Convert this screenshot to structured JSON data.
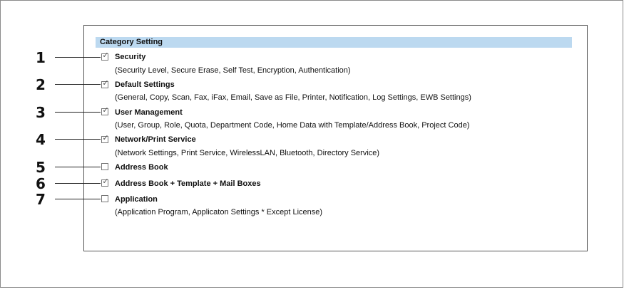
{
  "category_setting": {
    "header": "Category Setting",
    "items": [
      {
        "number": "1",
        "checked": true,
        "title": "Security",
        "description": "(Security Level, Secure Erase, Self Test, Encryption, Authentication)"
      },
      {
        "number": "2",
        "checked": true,
        "title": "Default Settings",
        "description": "(General, Copy, Scan, Fax, iFax, Email, Save as File, Printer, Notification, Log Settings, EWB Settings)"
      },
      {
        "number": "3",
        "checked": true,
        "title": "User Management",
        "description": "(User, Group, Role, Quota, Department Code, Home Data with Template/Address Book, Project Code)"
      },
      {
        "number": "4",
        "checked": true,
        "title": "Network/Print Service",
        "description": "(Network Settings, Print Service, WirelessLAN, Bluetooth, Directory Service)"
      },
      {
        "number": "5",
        "checked": false,
        "title": "Address Book",
        "description": ""
      },
      {
        "number": "6",
        "checked": true,
        "title": "Address Book + Template + Mail Boxes",
        "description": ""
      },
      {
        "number": "7",
        "checked": false,
        "title": "Application",
        "description": "(Application Program, Applicaton Settings * Except License)"
      }
    ]
  },
  "icons": {
    "checkmark": "check-icon"
  }
}
